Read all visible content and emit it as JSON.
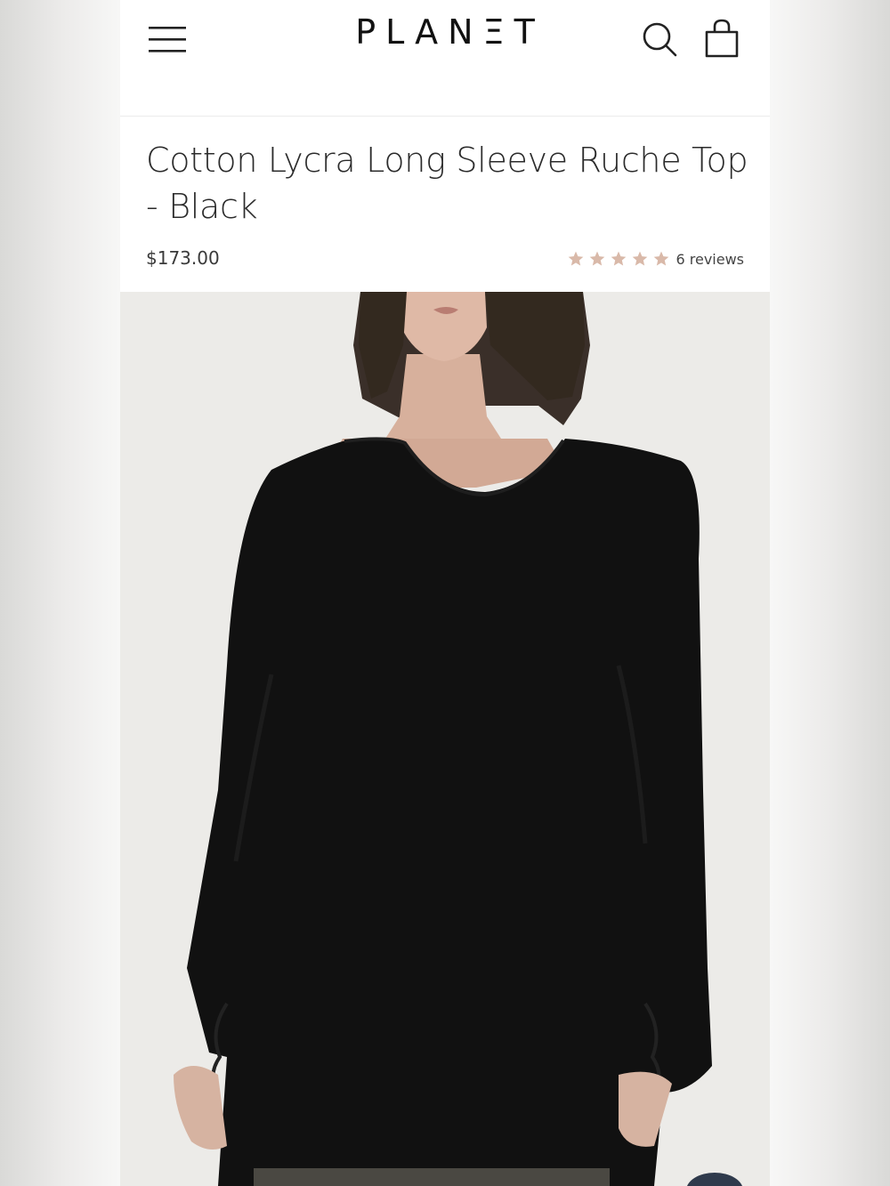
{
  "header": {
    "logo_text": "PLANΞT",
    "menu_icon": "hamburger-menu-icon",
    "search_icon": "search-icon",
    "cart_icon": "shopping-bag-icon"
  },
  "product": {
    "title": "Cotton Lycra Long Sleeve Ruche Top - Black",
    "price": "$173.00",
    "rating": 5,
    "reviews_label": "6 reviews",
    "star_color": "#d9b9a9",
    "color": "Black"
  },
  "image": {
    "subject": "model wearing black long sleeve ruched top"
  }
}
